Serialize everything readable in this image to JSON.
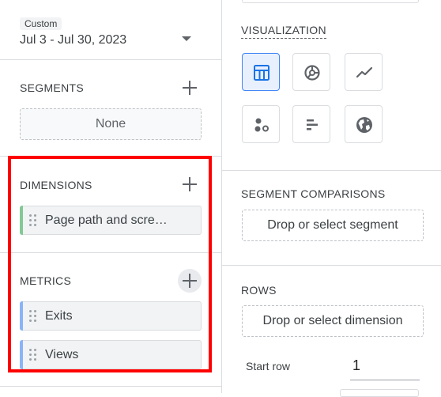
{
  "left_panel": {
    "date_chip": "Custom",
    "date_range": "Jul 3 - Jul 30, 2023",
    "segments": {
      "title": "SEGMENTS",
      "placeholder": "None"
    },
    "dimensions": {
      "title": "DIMENSIONS",
      "items": [
        {
          "label": "Page path and scre…",
          "color": "#81c995"
        }
      ]
    },
    "metrics": {
      "title": "METRICS",
      "items": [
        {
          "label": "Exits",
          "color": "#8ab4f8"
        },
        {
          "label": "Views",
          "color": "#8ab4f8"
        }
      ]
    },
    "highlight_color": "#ff0000"
  },
  "right_panel": {
    "visualization": {
      "title": "VISUALIZATION",
      "options": [
        "table-icon",
        "donut-chart-icon",
        "line-chart-icon",
        "scatter-plot-icon",
        "bar-chart-icon",
        "globe-icon"
      ],
      "selected": "table-icon"
    },
    "segment_comparisons": {
      "title": "SEGMENT COMPARISONS",
      "placeholder": "Drop or select segment"
    },
    "rows": {
      "title": "ROWS",
      "placeholder": "Drop or select dimension",
      "start_row_label": "Start row",
      "start_row_value": "1"
    }
  }
}
